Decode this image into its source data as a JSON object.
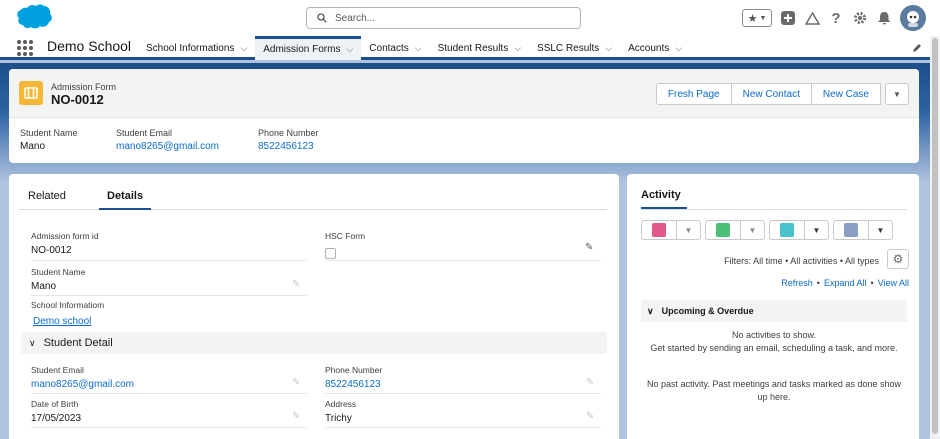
{
  "search": {
    "placeholder": "Search..."
  },
  "app": {
    "name": "Demo School"
  },
  "nav": {
    "tabs": [
      {
        "label": "School Informations"
      },
      {
        "label": "Admission Forms"
      },
      {
        "label": "Contacts"
      },
      {
        "label": "Student Results"
      },
      {
        "label": "SSLC Results"
      },
      {
        "label": "Accounts"
      }
    ],
    "active_tab": "Admission Forms"
  },
  "record": {
    "object_label": "Admission Form",
    "name": "NO-0012",
    "actions": [
      "Fresh Page",
      "New Contact",
      "New Case"
    ],
    "highlights": [
      {
        "label": "Student Name",
        "value": "Mano"
      },
      {
        "label": "Student Email",
        "value": "mano8265@gmail.com"
      },
      {
        "label": "Phone Number",
        "value": "8522456123"
      }
    ]
  },
  "detail": {
    "tabs": [
      "Related",
      "Details"
    ],
    "active_tab": "Details",
    "fields": {
      "admission_form_id": {
        "label": "Admission form id",
        "value": "NO-0012"
      },
      "hsc_form": {
        "label": "HSC Form"
      },
      "student_name": {
        "label": "Student Name",
        "value": "Mano"
      },
      "school_information": {
        "label": "School Informatiom",
        "value": "Demo school"
      },
      "student_email": {
        "label": "Student Email",
        "value": "mano8265@gmail.com"
      },
      "phone_number": {
        "label": "Phone Number",
        "value": "8522456123"
      },
      "date_of_birth": {
        "label": "Date of Birth",
        "value": "17/05/2023"
      },
      "address": {
        "label": "Address",
        "value": "Trichy"
      }
    },
    "section_title": "Student Detail"
  },
  "activity": {
    "title": "Activity",
    "filters": "Filters: All time • All activities • All types",
    "links": {
      "refresh": "Refresh",
      "expand_all": "Expand All",
      "view_all": "View All",
      "sep": "•"
    },
    "upcoming_title": "Upcoming & Overdue",
    "no_activities": "No activities to show.",
    "get_started": "Get started by sending an email, scheduling a task, and more.",
    "no_past": "No past activity. Past meetings and tasks marked as done show up here."
  },
  "colors": {
    "brand": "#1b5297",
    "link": "#0b6bcb",
    "object_icon": "#f5b836"
  }
}
